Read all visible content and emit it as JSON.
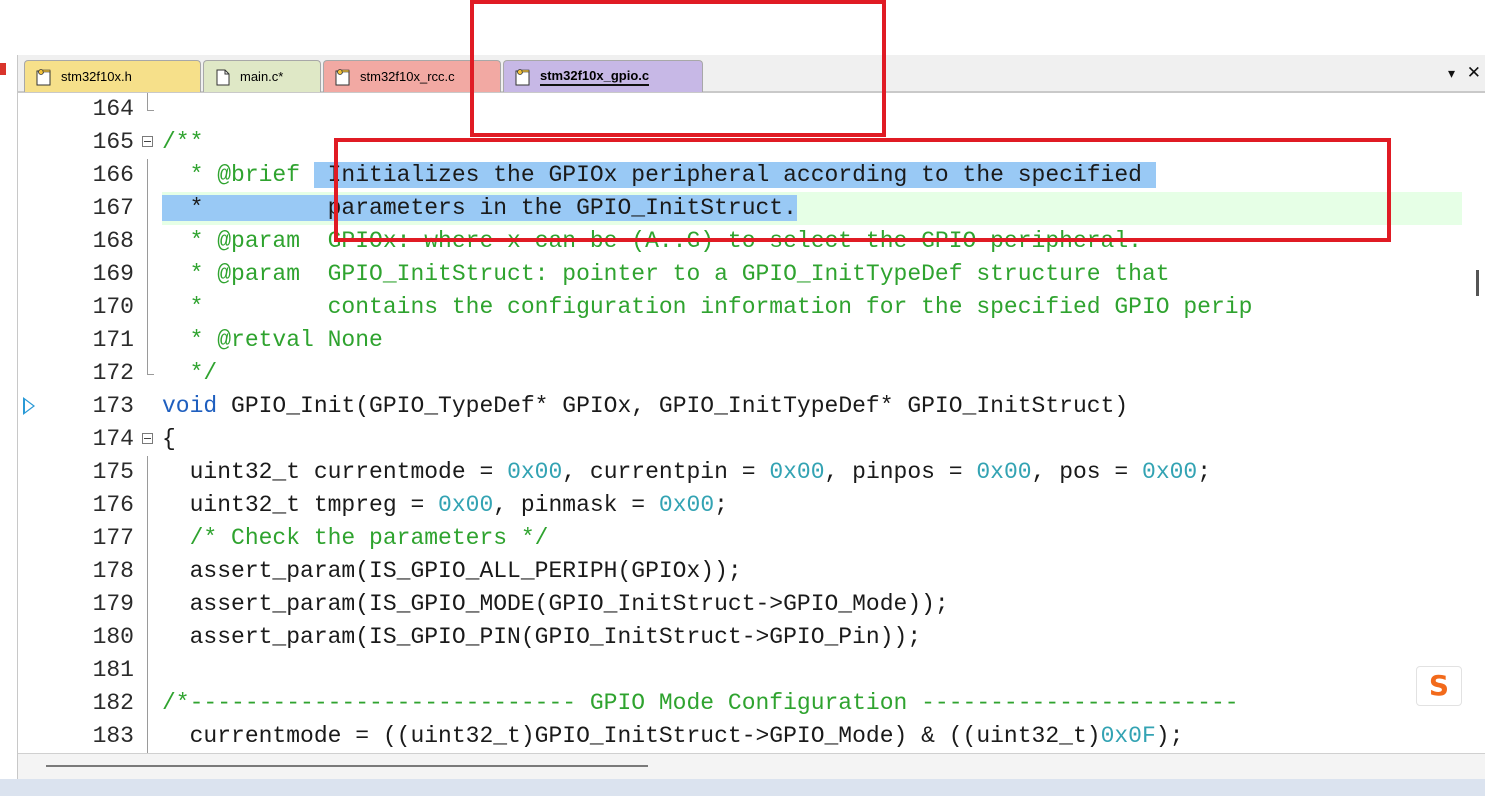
{
  "tabs": [
    {
      "label": "stm32f10x.h",
      "icon": "header-file-icon",
      "color": "#f6e08a",
      "active": false
    },
    {
      "label": "main.c*",
      "icon": "source-file-icon",
      "color": "#dfe8c6",
      "active": false
    },
    {
      "label": "stm32f10x_rcc.c",
      "icon": "source-file-icon",
      "color": "#f2a9a3",
      "active": false
    },
    {
      "label": "stm32f10x_gpio.c",
      "icon": "source-file-icon",
      "color": "#c7b8e6",
      "active": true
    }
  ],
  "tab_dropdown_glyph": "▾",
  "tab_close_glyph": "✕",
  "editor": {
    "current_line": 173,
    "selection_color": "#99c9f5",
    "lines": [
      {
        "n": "164",
        "text": ""
      },
      {
        "n": "165",
        "text": "/**"
      },
      {
        "n": "166",
        "text": "  * @brief  Initializes the GPIOx peripheral according to the specified"
      },
      {
        "n": "167",
        "text": "  *         parameters in the GPIO_InitStruct."
      },
      {
        "n": "168",
        "text": "  * @param  GPIOx: where x can be (A..G) to select the GPIO peripheral."
      },
      {
        "n": "169",
        "text": "  * @param  GPIO_InitStruct: pointer to a GPIO_InitTypeDef structure that"
      },
      {
        "n": "170",
        "text": "  *         contains the configuration information for the specified GPIO perip"
      },
      {
        "n": "171",
        "text": "  * @retval None"
      },
      {
        "n": "172",
        "text": "  */"
      },
      {
        "n": "173",
        "text": "void GPIO_Init(GPIO_TypeDef* GPIOx, GPIO_InitTypeDef* GPIO_InitStruct)"
      },
      {
        "n": "174",
        "text": "{"
      },
      {
        "n": "175",
        "text": "  uint32_t currentmode = 0x00, currentpin = 0x00, pinpos = 0x00, pos = 0x00;"
      },
      {
        "n": "176",
        "text": "  uint32_t tmpreg = 0x00, pinmask = 0x00;"
      },
      {
        "n": "177",
        "text": "  /* Check the parameters */"
      },
      {
        "n": "178",
        "text": "  assert_param(IS_GPIO_ALL_PERIPH(GPIOx));"
      },
      {
        "n": "179",
        "text": "  assert_param(IS_GPIO_MODE(GPIO_InitStruct->GPIO_Mode));"
      },
      {
        "n": "180",
        "text": "  assert_param(IS_GPIO_PIN(GPIO_InitStruct->GPIO_Pin));"
      },
      {
        "n": "181",
        "text": ""
      },
      {
        "n": "182",
        "text": "/*---------------------------- GPIO Mode Configuration -----------------------"
      },
      {
        "n": "183",
        "text": "  currentmode = ((uint32_t)GPIO_InitStruct->GPIO_Mode) & ((uint32_t)0x0F);"
      }
    ]
  },
  "ime_badge": "S",
  "annotation_color": "#e01b24"
}
